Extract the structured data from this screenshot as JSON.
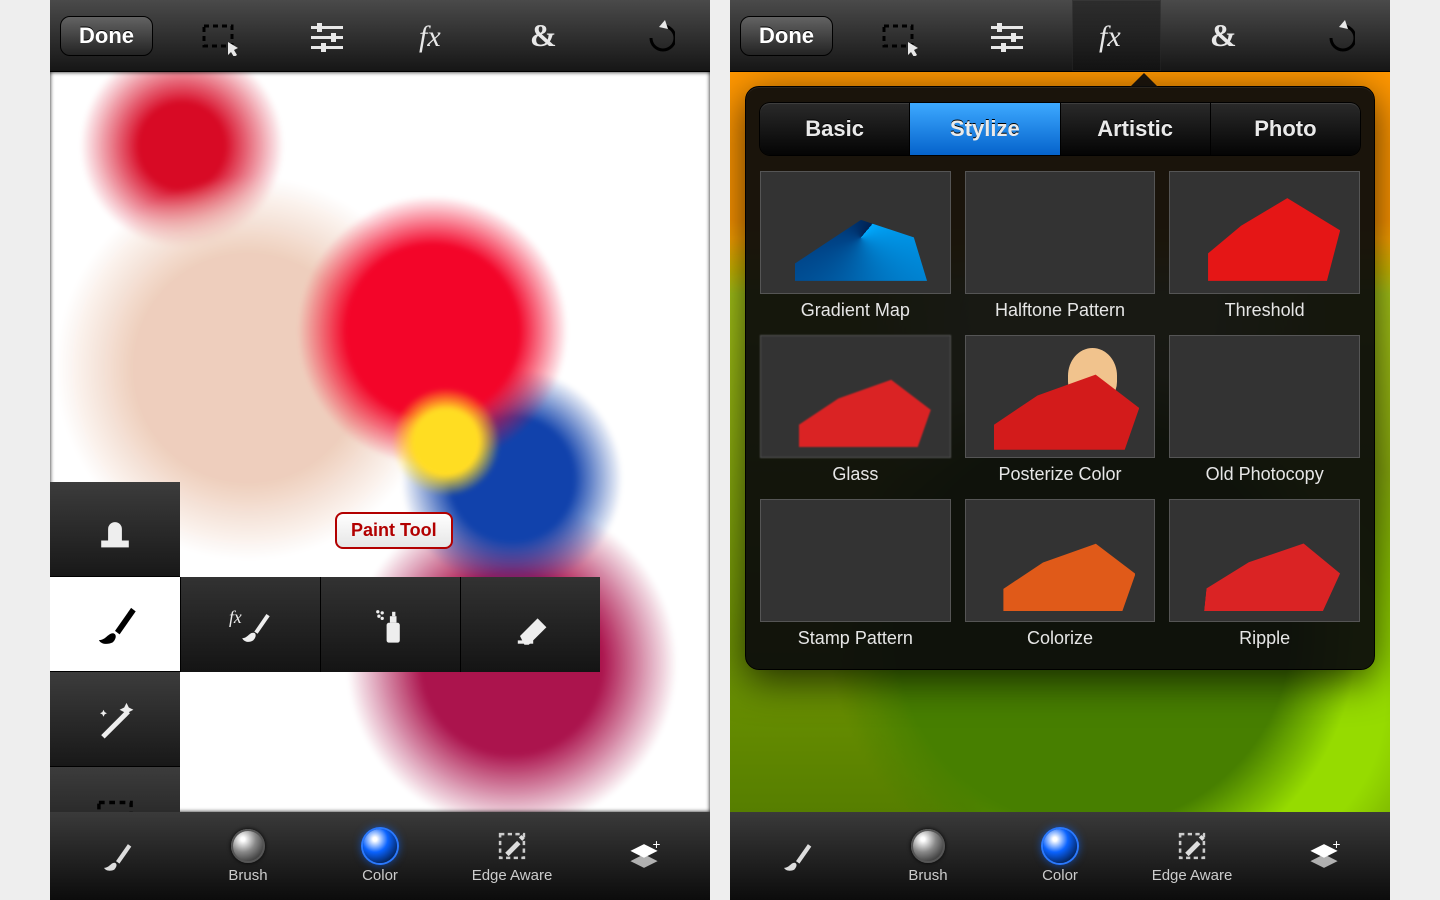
{
  "topbar": {
    "done": "Done"
  },
  "tooltip": {
    "paint": "Paint Tool"
  },
  "bottombar": {
    "brush": "Brush",
    "color": "Color",
    "edge": "Edge Aware"
  },
  "fx": {
    "tabs": {
      "basic": "Basic",
      "stylize": "Stylize",
      "artistic": "Artistic",
      "photo": "Photo"
    },
    "items": {
      "grad": "Gradient Map",
      "half": "Halftone Pattern",
      "thresh": "Threshold",
      "glass": "Glass",
      "poster": "Posterize Color",
      "photo": "Old Photocopy",
      "stamp": "Stamp Pattern",
      "color": "Colorize",
      "ripple": "Ripple"
    }
  }
}
